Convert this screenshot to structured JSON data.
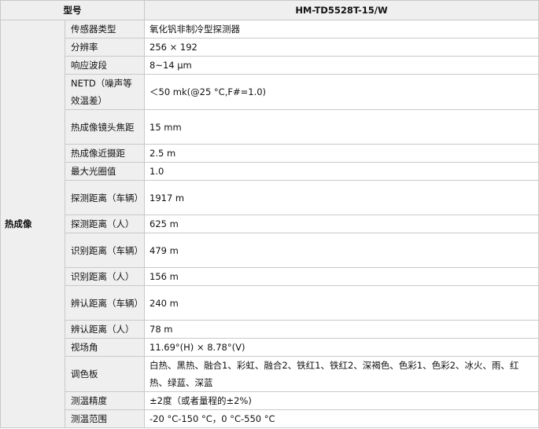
{
  "header": {
    "model_label": "型号",
    "model_value": "HM-TD5528T-15/W"
  },
  "category": "热成像",
  "rows": [
    {
      "label": "传感器类型",
      "value": "氧化钒非制冷型探测器"
    },
    {
      "label": "分辨率",
      "value": "256 × 192"
    },
    {
      "label": "响应波段",
      "value": "8~14 μm"
    },
    {
      "label": "NETD（噪声等效温差）",
      "value": "＜50 mk(@25 °C,F#=1.0)"
    },
    {
      "label": "热成像镜头焦距",
      "value": "15 mm"
    },
    {
      "label": "热成像近摄距",
      "value": "2.5 m"
    },
    {
      "label": "最大光圈值",
      "value": "1.0"
    },
    {
      "label": "探测距离（车辆）",
      "value": "1917 m"
    },
    {
      "label": "探测距离（人）",
      "value": "625 m"
    },
    {
      "label": "识别距离（车辆）",
      "value": "479 m"
    },
    {
      "label": "识别距离（人）",
      "value": "156 m"
    },
    {
      "label": "辨认距离（车辆）",
      "value": "240 m"
    },
    {
      "label": "辨认距离（人）",
      "value": "78 m"
    },
    {
      "label": "视场角",
      "value": "11.69°(H) × 8.78°(V)"
    },
    {
      "label": "调色板",
      "value": "白热、黑热、融合1、彩虹、融合2、铁红1、铁红2、深褐色、色彩1、色彩2、冰火、雨、红热、绿蓝、深蓝"
    },
    {
      "label": "测温精度",
      "value": "±2度（或者量程的±2%)"
    },
    {
      "label": "测温范围",
      "value": "-20 °C-150 °C，0 °C-550 °C"
    }
  ]
}
